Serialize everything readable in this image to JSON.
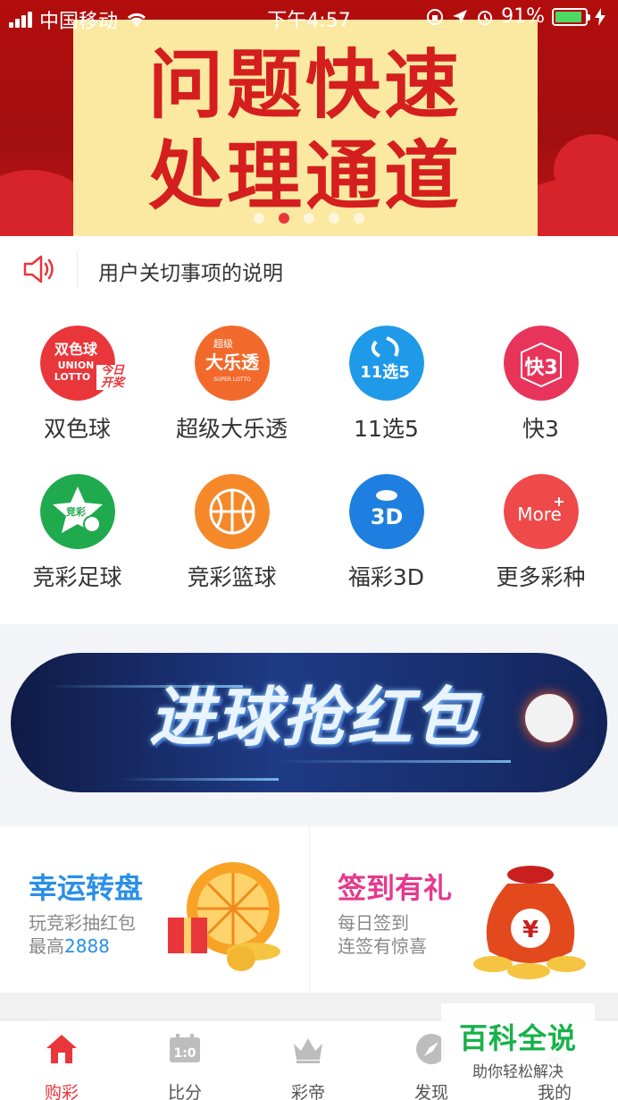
{
  "status_bar": {
    "carrier": "中国移动",
    "time": "下午4:57",
    "battery": "91%",
    "battery_level": 0.91
  },
  "hero": {
    "line1": "问题快速",
    "line2": "处理通道",
    "slide_count": 5,
    "active_slide": 1
  },
  "notice": {
    "text": "用户关切事项的说明"
  },
  "games": [
    {
      "label": "双色球",
      "icon": "union-lotto-icon",
      "color": "#e9363a"
    },
    {
      "label": "超级大乐透",
      "icon": "super-lotto-icon",
      "color": "#f26a2b"
    },
    {
      "label": "11选5",
      "icon": "11-choose-5-icon",
      "color": "#1e9ae8"
    },
    {
      "label": "快3",
      "icon": "kuai3-icon",
      "color": "#e8345a"
    },
    {
      "label": "竞彩足球",
      "icon": "football-icon",
      "color": "#1faa4e"
    },
    {
      "label": "竞彩篮球",
      "icon": "basketball-icon",
      "color": "#f5892a"
    },
    {
      "label": "福彩3D",
      "icon": "fucai-3d-icon",
      "color": "#1f7fe0"
    },
    {
      "label": "更多彩种",
      "icon": "more-icon",
      "color": "#ee4a4a"
    }
  ],
  "icon_text": {
    "union_1": "双色球",
    "union_2": "UNION",
    "union_3": "LOTTO",
    "union_badge": "今日开奖",
    "super_1": "超级",
    "super_2": "大乐透",
    "super_3": "SUPER LOTTO",
    "e115": "11选5",
    "kuai3": "快3",
    "football": "竞彩",
    "fc3d": "3D",
    "more": "More"
  },
  "promo": {
    "text": "进球抢红包"
  },
  "cards": [
    {
      "title": "幸运转盘",
      "line1": "玩竞彩抽红包",
      "line2_prefix": "最高",
      "line2_highlight": "2888",
      "color": "#2a8fe6"
    },
    {
      "title": "签到有礼",
      "line1": "每日签到",
      "line2": "连签有惊喜",
      "color": "#e5398c"
    }
  ],
  "card_art": {
    "money_sign": "¥"
  },
  "tabs": [
    {
      "label": "购彩",
      "icon": "home-icon",
      "active": true
    },
    {
      "label": "比分",
      "icon": "scoreboard-icon",
      "active": false
    },
    {
      "label": "彩帝",
      "icon": "crown-icon",
      "active": false
    },
    {
      "label": "发现",
      "icon": "compass-icon",
      "active": false
    },
    {
      "label": "我的",
      "icon": "profile-icon",
      "active": false
    }
  ],
  "tab_art": {
    "scoreboard": "1:0"
  },
  "watermark": {
    "title": "百科全说",
    "subtitle": "助你轻松解决"
  }
}
